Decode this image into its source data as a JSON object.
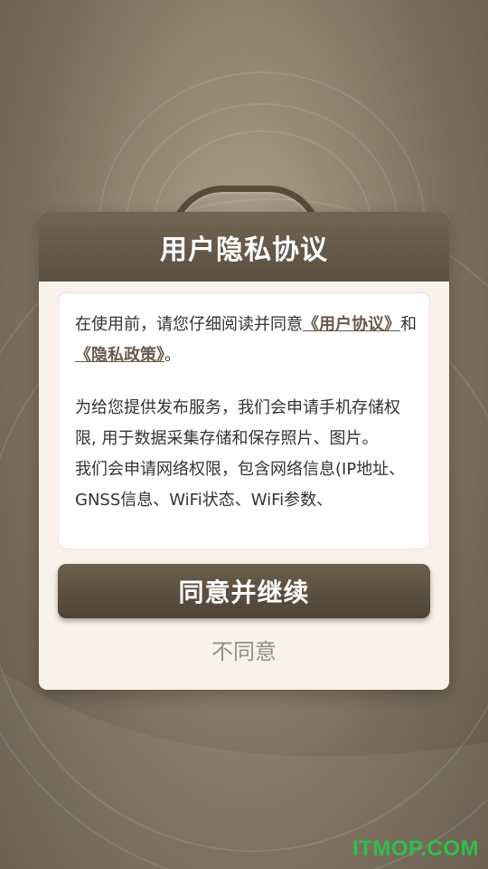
{
  "dialog": {
    "title": "用户隐私协议",
    "intro_prefix": "在使用前，请您仔细阅读并同意",
    "link_user_agreement": "《用户协议》",
    "intro_and": "和",
    "link_privacy_policy": "《隐私政策》",
    "intro_suffix": "。",
    "paragraph_storage": "为给您提供发布服务，我们会申请手机存储权限, 用于数据采集存储和保存照片、图片。",
    "paragraph_network": "我们会申请网络权限，包含网络信息(IP地址、GNSS信息、WiFi状态、WiFi参数、"
  },
  "buttons": {
    "agree_label": "同意并继续",
    "disagree_label": "不同意"
  },
  "watermark": "ITMOP.COM",
  "colors": {
    "header": "#5c4f40",
    "dialog_bg": "#f8f2e8",
    "link": "#6a5a48",
    "watermark": "#2fbf4f"
  }
}
